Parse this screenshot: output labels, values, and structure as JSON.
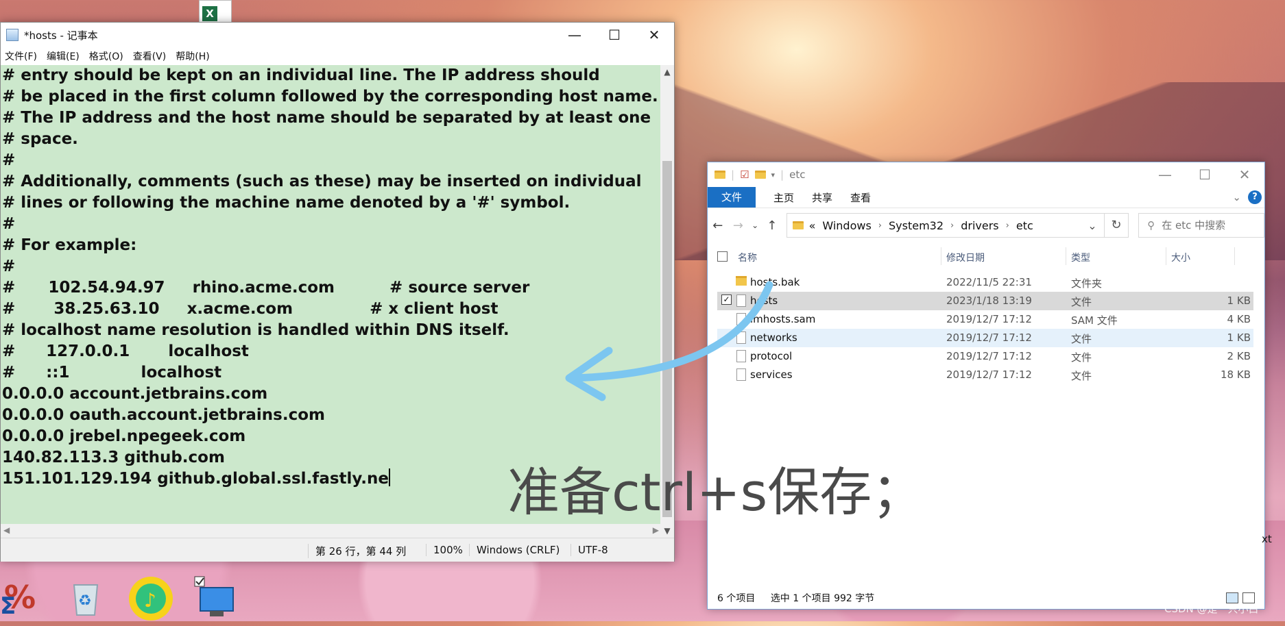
{
  "notepad": {
    "title": "*hosts - 记事本",
    "menu": [
      "文件(F)",
      "编辑(E)",
      "格式(O)",
      "查看(V)",
      "帮助(H)"
    ],
    "lines": [
      "# entry should be kept on an individual line. The IP address should",
      "# be placed in the first column followed by the corresponding host name.",
      "# The IP address and the host name should be separated by at least one",
      "# space.",
      "#",
      "# Additionally, comments (such as these) may be inserted on individual",
      "# lines or following the machine name denoted by a '#' symbol.",
      "#",
      "# For example:",
      "#",
      "#      102.54.94.97     rhino.acme.com          # source server",
      "#       38.25.63.10     x.acme.com              # x client host",
      "",
      "# localhost name resolution is handled within DNS itself.",
      "#\t127.0.0.1       localhost",
      "#\t::1             localhost",
      "0.0.0.0 account.jetbrains.com",
      "0.0.0.0 oauth.account.jetbrains.com",
      "0.0.0.0 jrebel.npegeek.com",
      "140.82.113.3 github.com",
      "151.101.129.194 github.global.ssl.fastly.ne"
    ],
    "status": {
      "position": "第 26 行，第 44 列",
      "zoom": "100%",
      "line_ending": "Windows (CRLF)",
      "encoding": "UTF-8"
    }
  },
  "explorer": {
    "title": "etc",
    "ribbon": {
      "file": "文件",
      "tabs": [
        "主页",
        "共享",
        "查看"
      ]
    },
    "address": {
      "prefix": "«",
      "crumbs": [
        "Windows",
        "System32",
        "drivers",
        "etc"
      ]
    },
    "search_placeholder": "在 etc 中搜索",
    "columns": {
      "name": "名称",
      "date": "修改日期",
      "type": "类型",
      "size": "大小"
    },
    "files": [
      {
        "name": "hosts.bak",
        "date": "2022/11/5 22:31",
        "type": "文件夹",
        "size": "",
        "kind": "folder"
      },
      {
        "name": "hosts",
        "date": "2023/1/18 13:19",
        "type": "文件",
        "size": "1 KB",
        "kind": "file"
      },
      {
        "name": "lmhosts.sam",
        "date": "2019/12/7 17:12",
        "type": "SAM 文件",
        "size": "4 KB",
        "kind": "file"
      },
      {
        "name": "networks",
        "date": "2019/12/7 17:12",
        "type": "文件",
        "size": "1 KB",
        "kind": "file"
      },
      {
        "name": "protocol",
        "date": "2019/12/7 17:12",
        "type": "文件",
        "size": "2 KB",
        "kind": "file"
      },
      {
        "name": "services",
        "date": "2019/12/7 17:12",
        "type": "文件",
        "size": "18 KB",
        "kind": "file"
      }
    ],
    "status": {
      "count": "6 个项目",
      "selection": "选中 1 个项目  992 字节"
    }
  },
  "annotation": {
    "text": "准备ctrl+s保存；",
    "arrow_color": "#7cc6f0"
  },
  "desktop": {
    "edge_label": "xt"
  },
  "watermark": "CSDN @是一只小白"
}
